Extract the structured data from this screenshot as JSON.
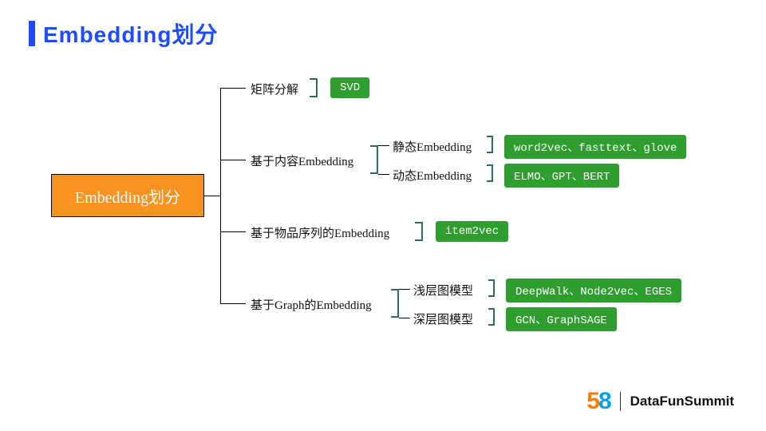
{
  "title": "Embedding划分",
  "root": "Embedding划分",
  "branches": [
    {
      "label": "矩阵分解",
      "tags": [
        "SVD"
      ]
    },
    {
      "label": "基于内容Embedding",
      "children": [
        {
          "label": "静态Embedding",
          "tags": [
            "word2vec、fasttext、glove"
          ]
        },
        {
          "label": "动态Embedding",
          "tags": [
            "ELMO、GPT、BERT"
          ]
        }
      ]
    },
    {
      "label": "基于物品序列的Embedding",
      "tags": [
        "item2vec"
      ]
    },
    {
      "label": "基于Graph的Embedding",
      "children": [
        {
          "label": "浅层图模型",
          "tags": [
            "DeepWalk、Node2vec、EGES"
          ]
        },
        {
          "label": "深层图模型",
          "tags": [
            "GCN、GraphSAGE"
          ]
        }
      ]
    }
  ],
  "footer": {
    "logo": "58",
    "text": "DataFunSummit"
  }
}
